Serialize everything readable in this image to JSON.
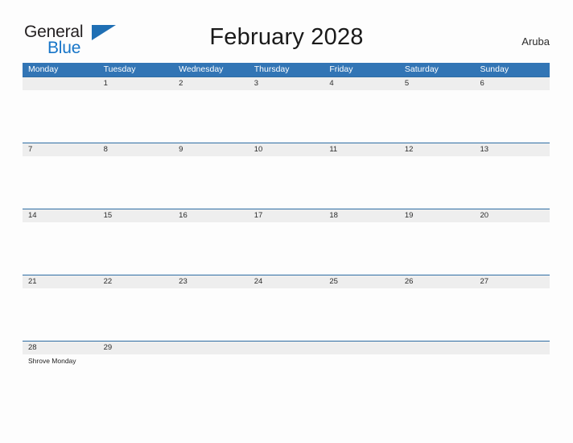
{
  "brand": {
    "name_top": "General",
    "name_bottom": "Blue",
    "flag_icon": "blue-triangle-flag-icon",
    "accent_color": "#1f6fb4",
    "blue_text_color": "#1675c8"
  },
  "header": {
    "title": "February 2028",
    "region": "Aruba"
  },
  "calendar": {
    "header_bg": "#3275b5",
    "band_bg": "#eeeeee",
    "separator_color": "#2e6da4",
    "weekday_headers": [
      "Monday",
      "Tuesday",
      "Wednesday",
      "Thursday",
      "Friday",
      "Saturday",
      "Sunday"
    ],
    "weeks": [
      {
        "days": [
          {
            "num": "",
            "event": ""
          },
          {
            "num": "1",
            "event": ""
          },
          {
            "num": "2",
            "event": ""
          },
          {
            "num": "3",
            "event": ""
          },
          {
            "num": "4",
            "event": ""
          },
          {
            "num": "5",
            "event": ""
          },
          {
            "num": "6",
            "event": ""
          }
        ]
      },
      {
        "days": [
          {
            "num": "7",
            "event": ""
          },
          {
            "num": "8",
            "event": ""
          },
          {
            "num": "9",
            "event": ""
          },
          {
            "num": "10",
            "event": ""
          },
          {
            "num": "11",
            "event": ""
          },
          {
            "num": "12",
            "event": ""
          },
          {
            "num": "13",
            "event": ""
          }
        ]
      },
      {
        "days": [
          {
            "num": "14",
            "event": ""
          },
          {
            "num": "15",
            "event": ""
          },
          {
            "num": "16",
            "event": ""
          },
          {
            "num": "17",
            "event": ""
          },
          {
            "num": "18",
            "event": ""
          },
          {
            "num": "19",
            "event": ""
          },
          {
            "num": "20",
            "event": ""
          }
        ]
      },
      {
        "days": [
          {
            "num": "21",
            "event": ""
          },
          {
            "num": "22",
            "event": ""
          },
          {
            "num": "23",
            "event": ""
          },
          {
            "num": "24",
            "event": ""
          },
          {
            "num": "25",
            "event": ""
          },
          {
            "num": "26",
            "event": ""
          },
          {
            "num": "27",
            "event": ""
          }
        ]
      },
      {
        "days": [
          {
            "num": "28",
            "event": "Shrove Monday"
          },
          {
            "num": "29",
            "event": ""
          },
          {
            "num": "",
            "event": ""
          },
          {
            "num": "",
            "event": ""
          },
          {
            "num": "",
            "event": ""
          },
          {
            "num": "",
            "event": ""
          },
          {
            "num": "",
            "event": ""
          }
        ]
      }
    ]
  }
}
